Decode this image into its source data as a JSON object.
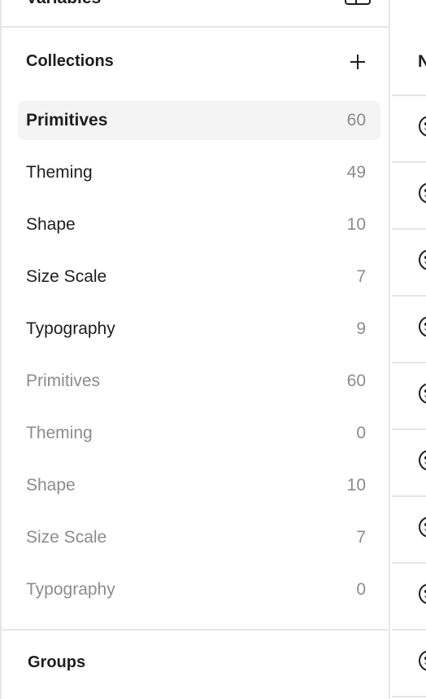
{
  "panel": {
    "top_title": "Variables",
    "collections_title": "Collections",
    "groups_title": "Groups"
  },
  "collections": [
    {
      "label": "Primitives",
      "count": "60",
      "state": "selected"
    },
    {
      "label": "Theming",
      "count": "49",
      "state": "normal"
    },
    {
      "label": "Shape",
      "count": "10",
      "state": "normal"
    },
    {
      "label": "Size Scale",
      "count": "7",
      "state": "normal"
    },
    {
      "label": "Typography",
      "count": "9",
      "state": "normal"
    },
    {
      "label": "Primitives",
      "count": "60",
      "state": "muted"
    },
    {
      "label": "Theming",
      "count": "0",
      "state": "muted"
    },
    {
      "label": "Shape",
      "count": "10",
      "state": "muted"
    },
    {
      "label": "Size Scale",
      "count": "7",
      "state": "muted"
    },
    {
      "label": "Typography",
      "count": "0",
      "state": "muted"
    }
  ],
  "right_column": {
    "header_letter": "N"
  },
  "colors": {
    "text": "#1e1e1e",
    "muted_text": "#8c8c8c",
    "selected_bg": "#f4f4f4",
    "border": "#e6e6e6"
  },
  "icons": {
    "add": "plus-icon",
    "top": "table-icon",
    "variable": "smiley-icon"
  }
}
